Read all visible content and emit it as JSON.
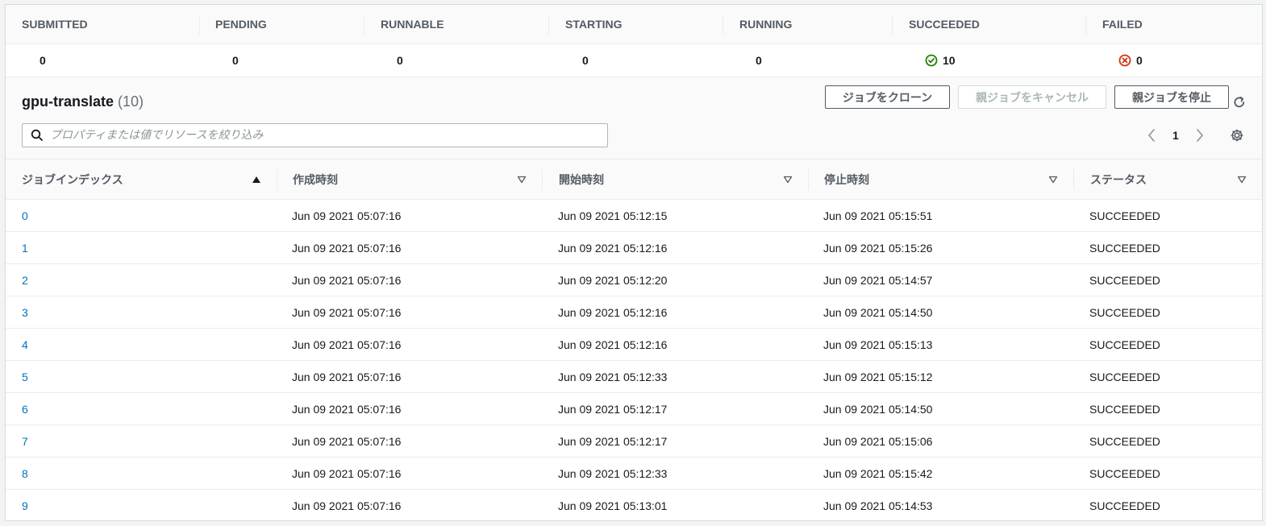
{
  "status_summary": {
    "columns": [
      {
        "label": "SUBMITTED",
        "value": "0"
      },
      {
        "label": "PENDING",
        "value": "0"
      },
      {
        "label": "RUNNABLE",
        "value": "0"
      },
      {
        "label": "STARTING",
        "value": "0"
      },
      {
        "label": "RUNNING",
        "value": "0"
      },
      {
        "label": "SUCCEEDED",
        "value": "10",
        "icon": "check-circle-icon",
        "color": "#1d8102"
      },
      {
        "label": "FAILED",
        "value": "0",
        "icon": "x-circle-icon",
        "color": "#d13212"
      }
    ]
  },
  "table": {
    "title": "gpu-translate",
    "count": "(10)",
    "actions": {
      "clone": "ジョブをクローン",
      "cancel_parent": "親ジョブをキャンセル",
      "stop_parent": "親ジョブを停止"
    },
    "search": {
      "placeholder": "プロパティまたは値でリソースを絞り込み"
    },
    "pagination": {
      "current_page": "1"
    },
    "headers": [
      "ジョブインデックス",
      "作成時刻",
      "開始時刻",
      "停止時刻",
      "ステータス"
    ],
    "sort": {
      "column": "ジョブインデックス",
      "direction": "ascending"
    },
    "rows": [
      [
        "0",
        "Jun 09 2021 05:07:16",
        "Jun 09 2021 05:12:15",
        "Jun 09 2021 05:15:51",
        "SUCCEEDED"
      ],
      [
        "1",
        "Jun 09 2021 05:07:16",
        "Jun 09 2021 05:12:16",
        "Jun 09 2021 05:15:26",
        "SUCCEEDED"
      ],
      [
        "2",
        "Jun 09 2021 05:07:16",
        "Jun 09 2021 05:12:20",
        "Jun 09 2021 05:14:57",
        "SUCCEEDED"
      ],
      [
        "3",
        "Jun 09 2021 05:07:16",
        "Jun 09 2021 05:12:16",
        "Jun 09 2021 05:14:50",
        "SUCCEEDED"
      ],
      [
        "4",
        "Jun 09 2021 05:07:16",
        "Jun 09 2021 05:12:16",
        "Jun 09 2021 05:15:13",
        "SUCCEEDED"
      ],
      [
        "5",
        "Jun 09 2021 05:07:16",
        "Jun 09 2021 05:12:33",
        "Jun 09 2021 05:15:12",
        "SUCCEEDED"
      ],
      [
        "6",
        "Jun 09 2021 05:07:16",
        "Jun 09 2021 05:12:17",
        "Jun 09 2021 05:14:50",
        "SUCCEEDED"
      ],
      [
        "7",
        "Jun 09 2021 05:07:16",
        "Jun 09 2021 05:12:17",
        "Jun 09 2021 05:15:06",
        "SUCCEEDED"
      ],
      [
        "8",
        "Jun 09 2021 05:07:16",
        "Jun 09 2021 05:12:33",
        "Jun 09 2021 05:15:42",
        "SUCCEEDED"
      ],
      [
        "9",
        "Jun 09 2021 05:07:16",
        "Jun 09 2021 05:13:01",
        "Jun 09 2021 05:14:53",
        "SUCCEEDED"
      ]
    ]
  },
  "colors": {
    "link": "#0073bb",
    "text": "#16191f",
    "muted": "#545b64",
    "border": "#eaeded"
  }
}
